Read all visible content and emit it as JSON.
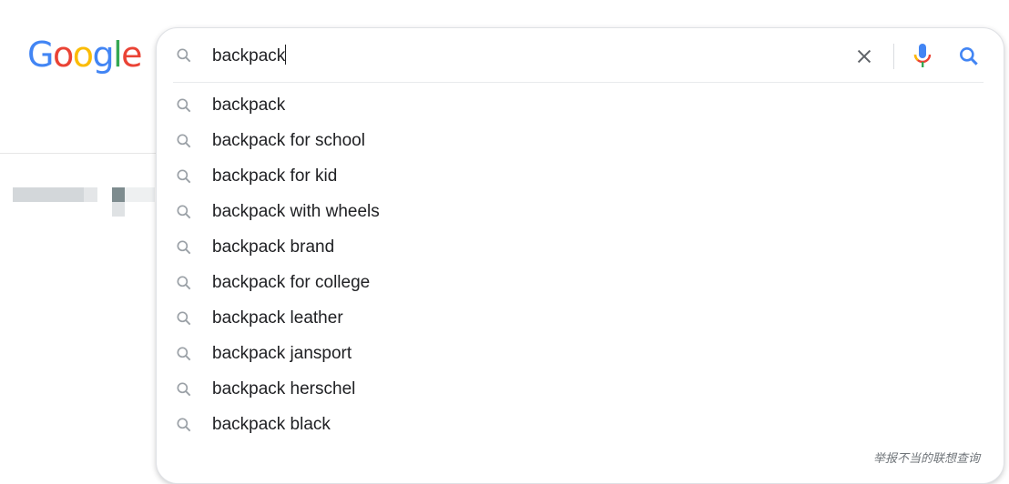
{
  "logo": {
    "text": "Google",
    "colors": [
      "#4285f4",
      "#ea4335",
      "#fbbc05",
      "#4285f4",
      "#34a853",
      "#ea4335"
    ]
  },
  "search": {
    "query": "backpack"
  },
  "icons": {
    "search": "search-icon",
    "clear": "close-icon",
    "voice": "microphone-icon",
    "submit": "search-icon"
  },
  "suggestions": [
    "backpack",
    "backpack for school",
    "backpack for kid",
    "backpack with wheels",
    "backpack brand",
    "backpack for college",
    "backpack leather",
    "backpack jansport",
    "backpack herschel",
    "backpack black"
  ],
  "footer": {
    "report_link": "举报不当的联想查询"
  }
}
